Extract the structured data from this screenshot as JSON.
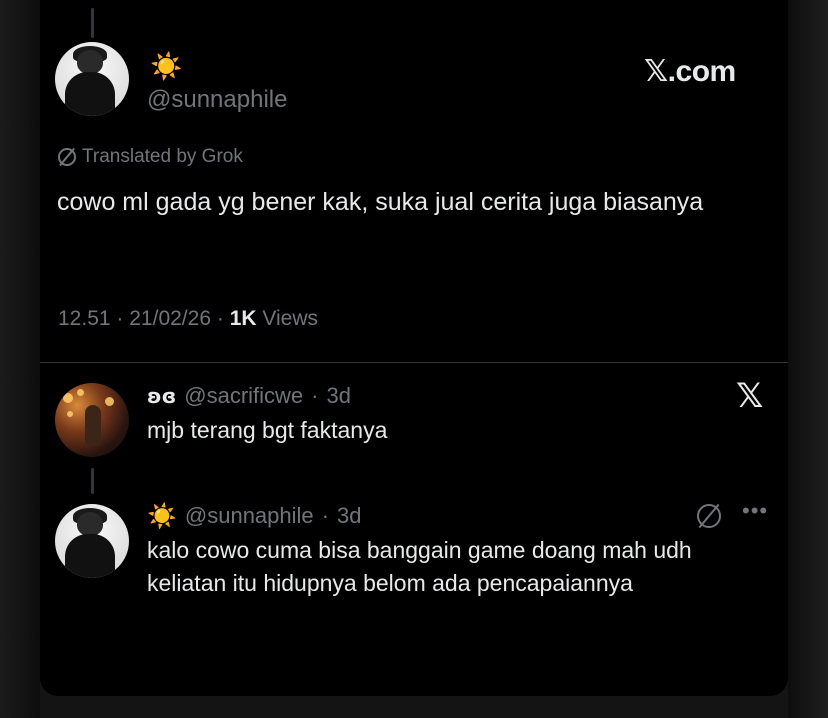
{
  "main_tweet": {
    "name_emoji": "☀️",
    "handle": "@sunnaphile",
    "watermark": "𝕏.com",
    "translated_label": "Translated by Grok",
    "text": "cowo ml gada yg bener kak, suka jual cerita juga biasanya",
    "time": "12.51",
    "date": "21/02/26",
    "views_count": "1K",
    "views_label": "Views",
    "sep": "·"
  },
  "reply1": {
    "name": "ʚɞ",
    "handle": "@sacrificwe",
    "sep": "·",
    "age": "3d",
    "text": "mjb terang bgt faktanya",
    "logo": "𝕏"
  },
  "reply2": {
    "name_emoji": "☀️",
    "handle": "@sunnaphile",
    "sep": "·",
    "age": "3d",
    "more": "•••",
    "text": "kalo cowo cuma bisa banggain game doang mah udh keliatan itu hidupnya belom ada pencapaiannya"
  },
  "colors": {
    "text": "#e7e9ea",
    "muted": "#71767b",
    "background": "#000000"
  }
}
